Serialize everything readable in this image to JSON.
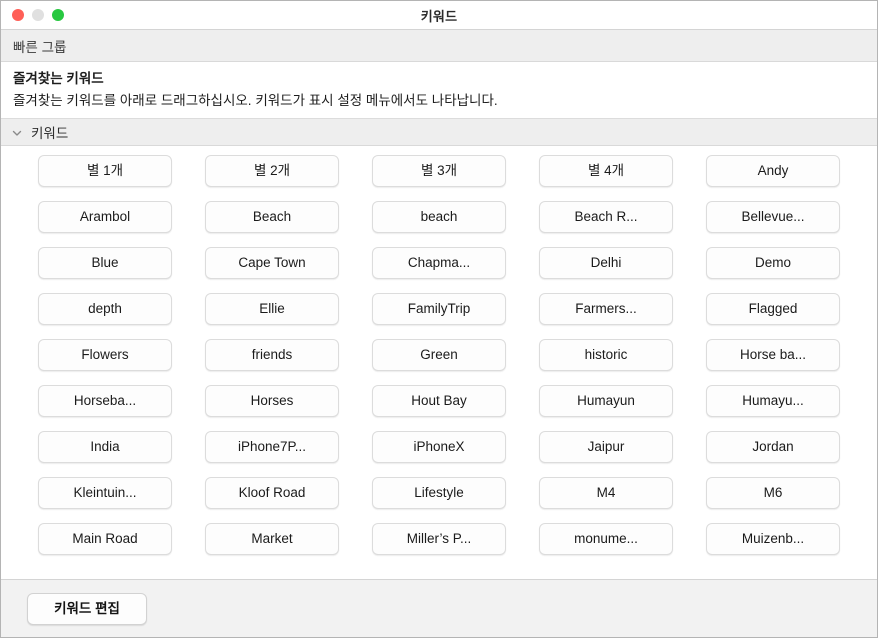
{
  "window": {
    "title": "키워드",
    "controls": {
      "close": "close-button",
      "minimize": "minimize-button",
      "zoom": "zoom-button"
    }
  },
  "quick_group": {
    "label": "빠른 그룹"
  },
  "favorites": {
    "title": "즐겨찾는 키워드",
    "description": "즐겨찾는 키워드를 아래로 드래그하십시오. 키워드가 표시 설정 메뉴에서도 나타납니다."
  },
  "keywords_section": {
    "label": "키워드",
    "disclosure_icon": "chevron-down-icon",
    "expanded": true,
    "columns": 5,
    "rows": 9,
    "items": [
      "별 1개",
      "별 2개",
      "별 3개",
      "별 4개",
      "Andy",
      "Arambol",
      "Beach",
      "beach",
      "Beach R...",
      "Bellevue...",
      "Blue",
      "Cape Town",
      "Chapma...",
      "Delhi",
      "Demo",
      "depth",
      "Ellie",
      "FamilyTrip",
      "Farmers...",
      "Flagged",
      "Flowers",
      "friends",
      "Green",
      "historic",
      "Horse ba...",
      "Horseba...",
      "Horses",
      "Hout Bay",
      "Humayun",
      "Humayu...",
      "India",
      "iPhone7P...",
      "iPhoneX",
      "Jaipur",
      "Jordan",
      "Kleintuin...",
      "Kloof Road",
      "Lifestyle",
      "M4",
      "M6",
      "Main Road",
      "Market",
      "Miller’s P...",
      "monume...",
      "Muizenb..."
    ]
  },
  "toolbar": {
    "edit_keywords_label": "키워드 편집"
  },
  "colors": {
    "close": "#ff5f57",
    "minimize": "#e0e0e0",
    "zoom": "#28c840",
    "header_bar": "#eeeeee",
    "bottom_bar": "#f2f2f2",
    "button_face": "#fdfdfd",
    "button_border": "#dcdcdc"
  }
}
